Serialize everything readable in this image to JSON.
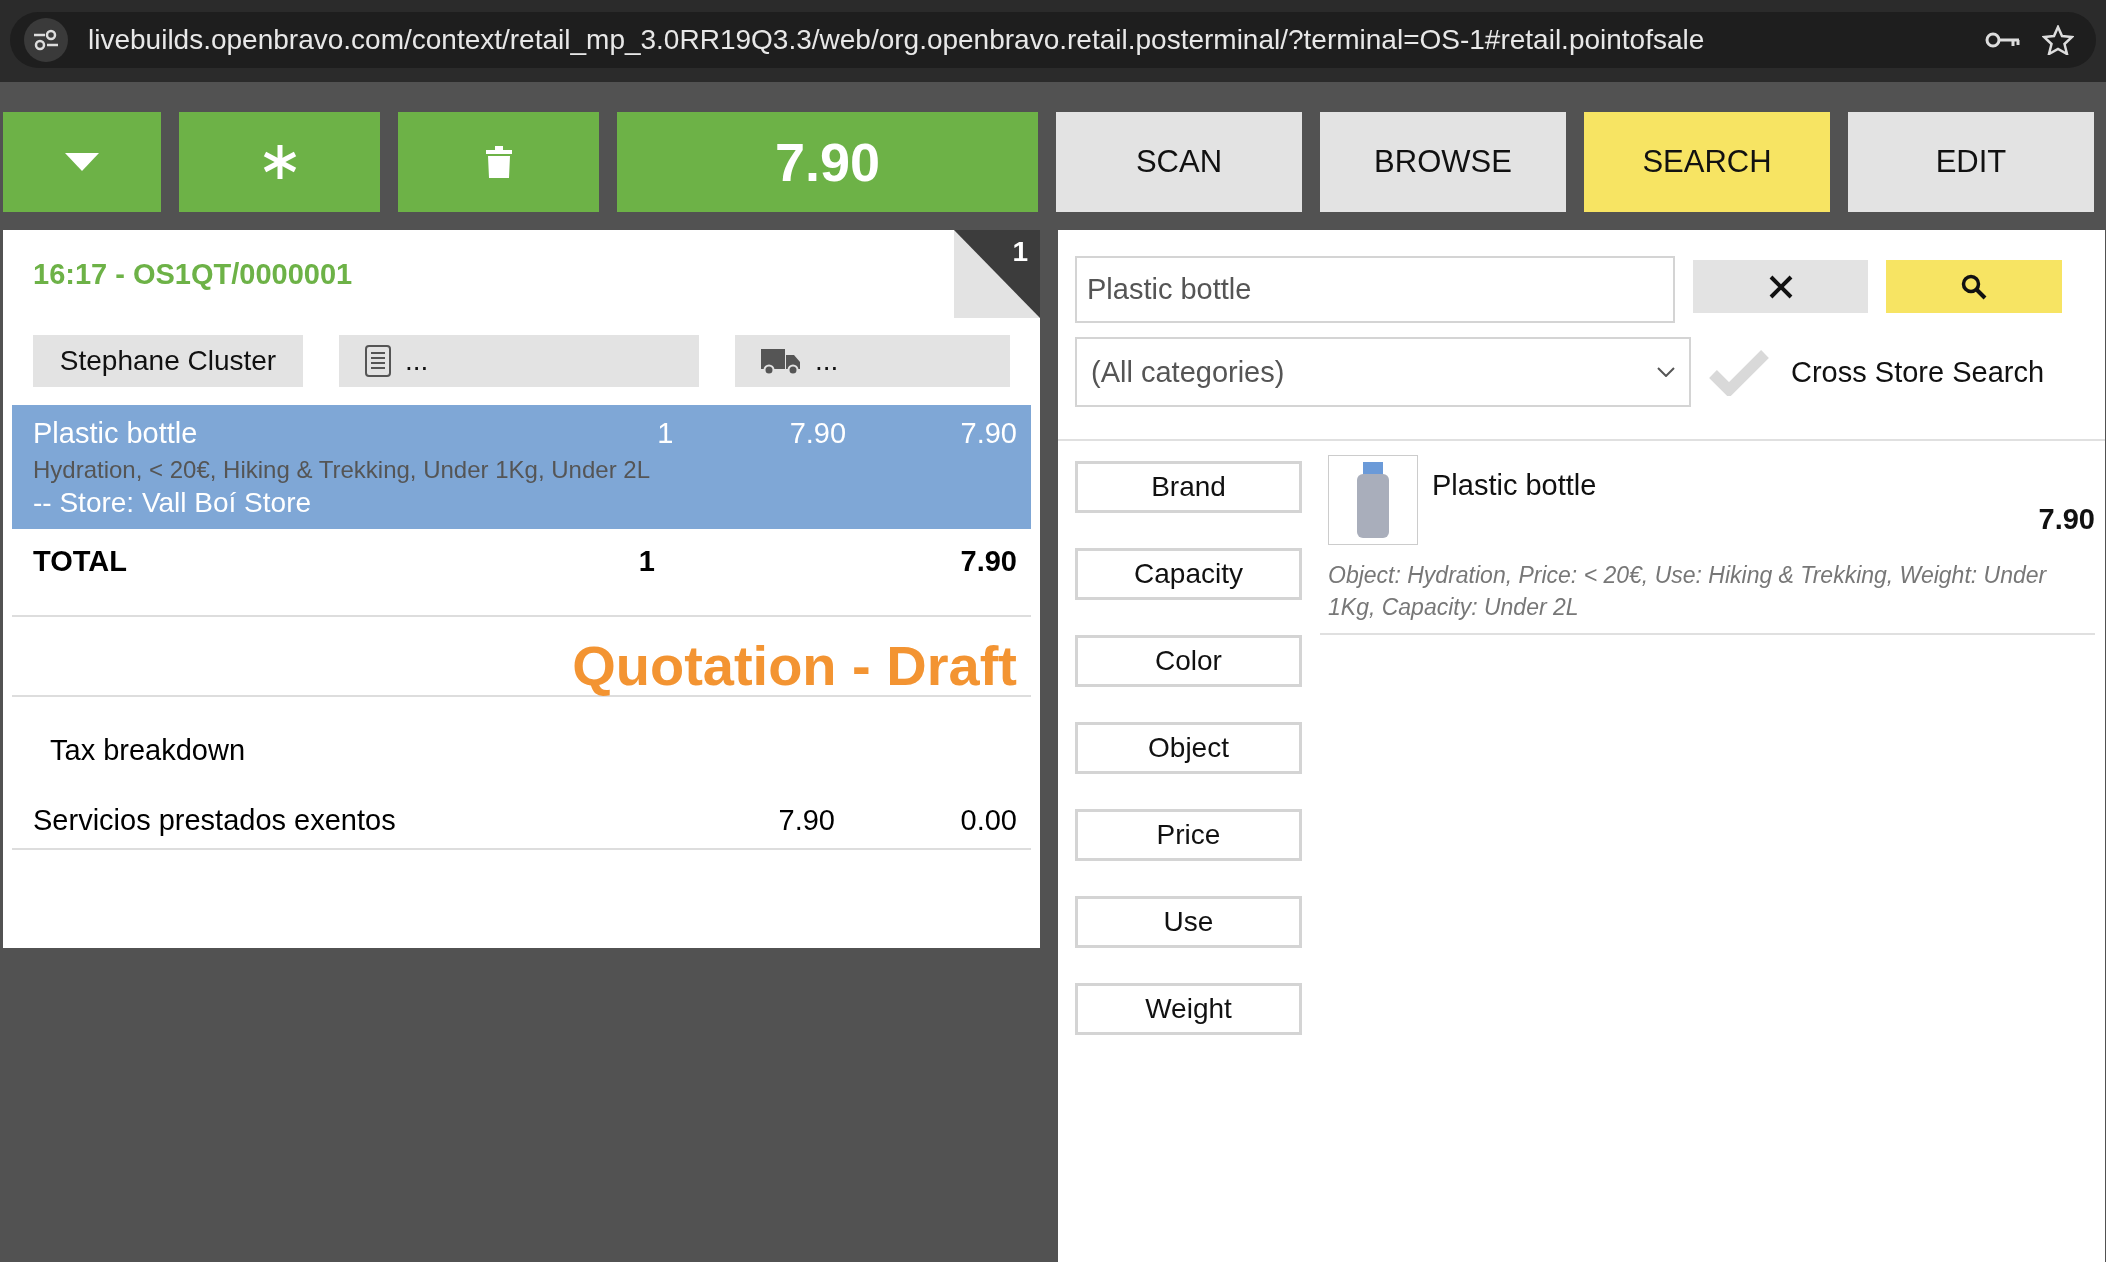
{
  "browser": {
    "url": "livebuilds.openbravo.com/context/retail_mp_3.0RR19Q3.3/web/org.openbravo.retail.posterminal/?terminal=OS-1#retail.pointofsale"
  },
  "toolbar": {
    "total": "7.90",
    "tabs": [
      {
        "label": "SCAN",
        "selected": false
      },
      {
        "label": "BROWSE",
        "selected": false
      },
      {
        "label": "SEARCH",
        "selected": true
      },
      {
        "label": "EDIT",
        "selected": false
      }
    ]
  },
  "receipt": {
    "order_no": "16:17 - OS1QT/0000001",
    "badge": "1",
    "customer": "Stephane Cluster",
    "invoice_field": "...",
    "shipping_field": "...",
    "lines": [
      {
        "product": "Plastic bottle",
        "quantity": "1",
        "price": "7.90",
        "amount": "7.90",
        "attributes": "Hydration, < 20€, Hiking & Trekking, Under 1Kg, Under 2L",
        "store": "-- Store: Vall Boí Store",
        "selected": true
      }
    ],
    "total": {
      "label": "TOTAL",
      "quantity": "1",
      "amount": "7.90"
    },
    "status": "Quotation - Draft",
    "tax_title": "Tax breakdown",
    "taxes": [
      {
        "name": "Servicios prestados exentos",
        "base": "7.90",
        "amount": "0.00"
      }
    ]
  },
  "search": {
    "value": "Plastic bottle",
    "category": "(All categories)",
    "cross_store": {
      "label": "Cross Store Search",
      "checked": false
    },
    "filters": [
      "Brand",
      "Capacity",
      "Color",
      "Object",
      "Price",
      "Use",
      "Weight"
    ],
    "results": [
      {
        "name": "Plastic bottle",
        "price": "7.90",
        "characteristics": "Object: Hydration, Price: < 20€, Use: Hiking & Trekking, Weight: Under 1Kg, Capacity: Under 2L"
      }
    ]
  }
}
